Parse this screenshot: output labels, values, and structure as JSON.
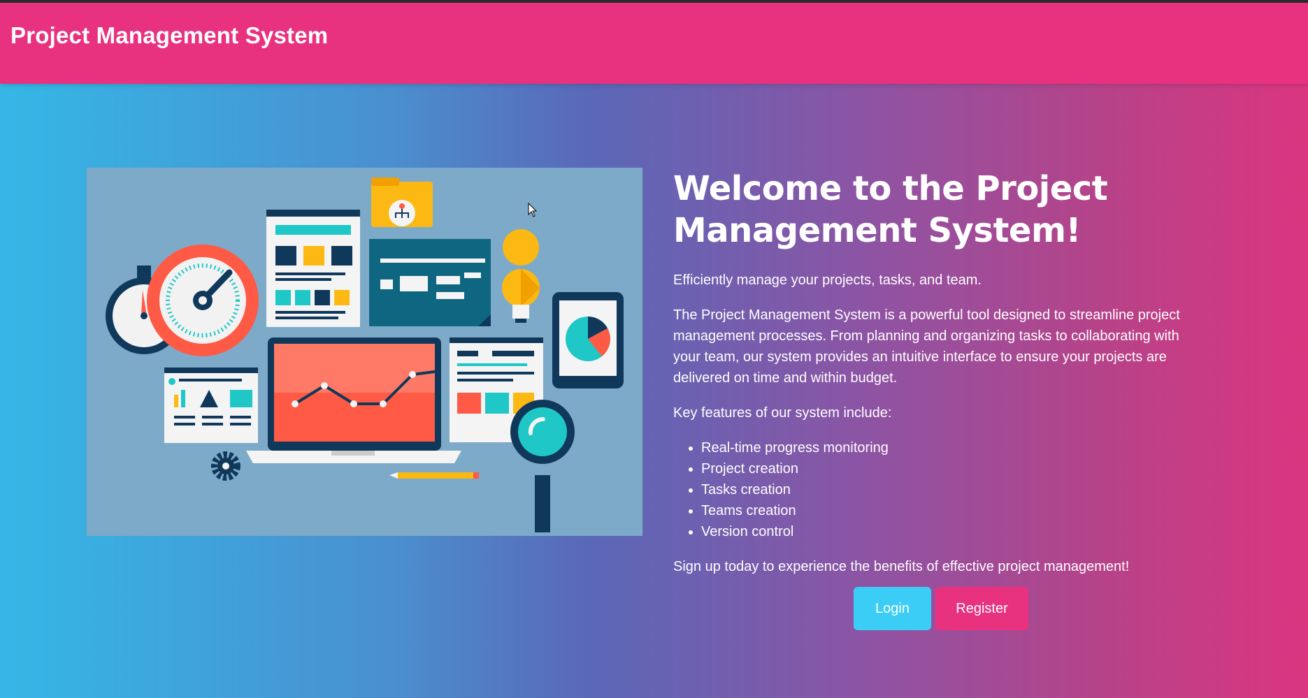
{
  "app": {
    "title": "Project Management System"
  },
  "main": {
    "heading": "Welcome to the Project Management System!",
    "tagline": "Efficiently manage your projects, tasks, and team.",
    "description": "The Project Management System is a powerful tool designed to streamline project management processes. From planning and organizing tasks to collaborating with your team, our system provides an intuitive interface to ensure your projects are delivered on time and within budget.",
    "features_intro": "Key features of our system include:",
    "features": [
      "Real-time progress monitoring",
      "Project creation",
      "Tasks creation",
      "Teams creation",
      "Version control"
    ],
    "signup": "Sign up today to experience the benefits of effective project management!"
  },
  "buttons": {
    "login": "Login",
    "register": "Register"
  },
  "colors": {
    "header": "#e9327f",
    "login": "#3ccdf6",
    "register": "#e9327f",
    "image_bg": "#7eaac9"
  }
}
